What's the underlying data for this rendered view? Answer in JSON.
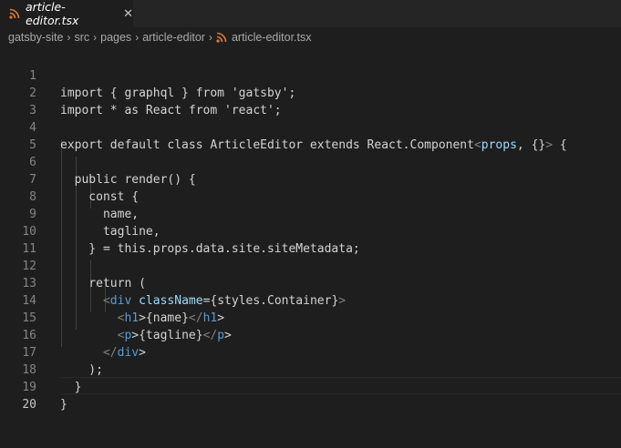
{
  "tab": {
    "label": "article-editor.tsx",
    "close": "✕",
    "icon": "rss-icon",
    "icon_color": "#e37933"
  },
  "breadcrumb": {
    "items": [
      "gatsby-site",
      "src",
      "pages",
      "article-editor",
      "article-editor.tsx"
    ],
    "separator": "›"
  },
  "editor": {
    "lines": [
      {
        "n": "1",
        "text": "import { graphql } from 'gatsby';"
      },
      {
        "n": "2",
        "text": "import * as React from 'react';"
      },
      {
        "n": "3",
        "text": ""
      },
      {
        "n": "4",
        "text": "export default class ArticleEditor extends React.Component<props, {}> {"
      },
      {
        "n": "5",
        "text": ""
      },
      {
        "n": "6",
        "text": "  public render() {"
      },
      {
        "n": "7",
        "text": "    const {"
      },
      {
        "n": "8",
        "text": "      name,"
      },
      {
        "n": "9",
        "text": "      tagline,"
      },
      {
        "n": "10",
        "text": "    } = this.props.data.site.siteMetadata;"
      },
      {
        "n": "11",
        "text": ""
      },
      {
        "n": "12",
        "text": "    return ("
      },
      {
        "n": "13",
        "text": "      <div className={styles.Container}>"
      },
      {
        "n": "14",
        "text": "        <h1>{name}</h1>"
      },
      {
        "n": "15",
        "text": "        <p>{tagline}</p>"
      },
      {
        "n": "16",
        "text": "      </div>"
      },
      {
        "n": "17",
        "text": "    );"
      },
      {
        "n": "18",
        "text": "  }"
      },
      {
        "n": "19",
        "text": "}"
      },
      {
        "n": "20",
        "text": ""
      }
    ],
    "active_line": "20"
  }
}
